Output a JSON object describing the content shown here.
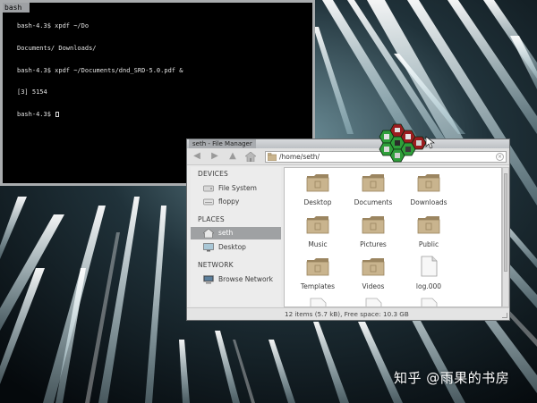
{
  "terminal": {
    "title": "bash",
    "lines": [
      "bash-4.3$ xpdf ~/Do",
      "Documents/ Downloads/",
      "bash-4.3$ xpdf ~/Documents/dnd_SRD-5.0.pdf &",
      "[3] 5154",
      "bash-4.3$ "
    ]
  },
  "file_manager": {
    "title": "seth - File Manager",
    "nav": {
      "back_icon": "arrow-left-icon",
      "forward_icon": "arrow-right-icon",
      "up_icon": "arrow-up-icon",
      "home_icon": "home-icon"
    },
    "path": "/home/seth/",
    "sidebar": {
      "sections": [
        {
          "heading": "DEVICES",
          "items": [
            {
              "label": "File System",
              "icon": "drive-icon"
            },
            {
              "label": "floppy",
              "icon": "floppy-icon"
            }
          ]
        },
        {
          "heading": "PLACES",
          "items": [
            {
              "label": "seth",
              "icon": "home-icon",
              "selected": true
            },
            {
              "label": "Desktop",
              "icon": "desktop-icon"
            }
          ]
        },
        {
          "heading": "NETWORK",
          "items": [
            {
              "label": "Browse Network",
              "icon": "network-icon"
            }
          ]
        }
      ]
    },
    "files": [
      {
        "label": "Desktop",
        "icon": "folder-icon"
      },
      {
        "label": "Documents",
        "icon": "folder-icon"
      },
      {
        "label": "Downloads",
        "icon": "folder-icon"
      },
      {
        "label": "Music",
        "icon": "folder-icon"
      },
      {
        "label": "Pictures",
        "icon": "folder-icon"
      },
      {
        "label": "Public",
        "icon": "folder-icon"
      },
      {
        "label": "Templates",
        "icon": "folder-icon"
      },
      {
        "label": "Videos",
        "icon": "folder-icon"
      },
      {
        "label": "log.000",
        "icon": "file-icon"
      }
    ],
    "status": "12 items (5.7 kB), Free space: 10.3 GB"
  },
  "watermark": "知乎 @雨果的书房",
  "colors": {
    "folder": "#c9b48e",
    "folder_dark": "#9b8560",
    "hex_green": "#2f9e3a",
    "hex_red": "#9b1c1f",
    "selection": "#9fa1a3"
  }
}
